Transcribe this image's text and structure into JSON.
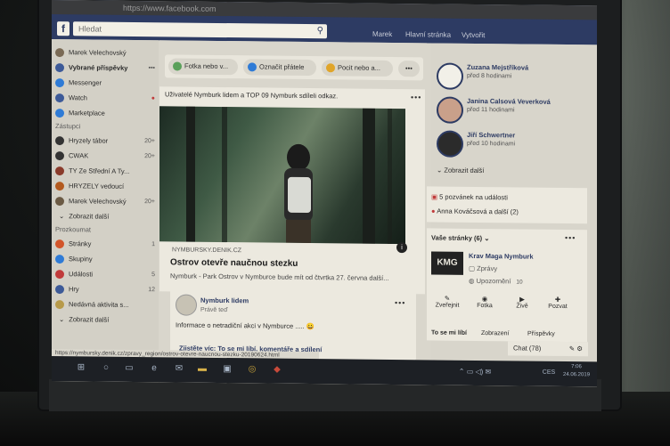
{
  "browser": {
    "url": "https://www.facebook.com",
    "status_url": "https://nymbursky.denik.cz/zpravy_region/ostrov-otevre-naucnou-stezku-20190624.html"
  },
  "fb": {
    "logo": "f",
    "search_placeholder": "Hledat",
    "nav": [
      "Marek",
      "Hlavní stránka",
      "Vytvořit"
    ]
  },
  "sidebar": {
    "profile": "Marek Velechovský",
    "items": [
      {
        "label": "Vybrané příspěvky",
        "color": "#3d5a98"
      },
      {
        "label": "Messenger",
        "color": "#2f7bd6"
      },
      {
        "label": "Watch",
        "color": "#3d5a98"
      },
      {
        "label": "Marketplace",
        "color": "#2f7bd6"
      }
    ],
    "shortcuts_title": "Zástupci",
    "shortcuts": [
      {
        "label": "Hryzely tábor",
        "count": "20+",
        "color": "#333"
      },
      {
        "label": "CWAK",
        "count": "20+",
        "color": "#333"
      },
      {
        "label": "TY Ze Střední A Ty...",
        "count": "",
        "color": "#8a3b2b"
      },
      {
        "label": "HRYZELY vedoucí",
        "count": "",
        "color": "#b35a1f"
      },
      {
        "label": "Marek Velechovský",
        "count": "20+",
        "color": "#6b5a44"
      }
    ],
    "shortcuts_more": "Zobrazit další",
    "explore_title": "Prozkoumat",
    "explore": [
      {
        "label": "Stránky",
        "count": "1",
        "color": "#d2552a"
      },
      {
        "label": "Skupiny",
        "count": "",
        "color": "#2f7bd6"
      },
      {
        "label": "Události",
        "count": "5",
        "color": "#c03b3b"
      },
      {
        "label": "Hry",
        "count": "12",
        "color": "#3d5a98"
      },
      {
        "label": "Nedávná aktivita s...",
        "count": "",
        "color": "#b79a4a"
      }
    ],
    "explore_more": "Zobrazit další"
  },
  "composer": {
    "buttons": [
      "Fotka nebo v...",
      "Označit přátele",
      "Pocit nebo a..."
    ]
  },
  "post": {
    "header": "Uživatelé Nymburk lidem a TOP 09 Nymburk sdíleli odkaz.",
    "domain": "NYMBURSKY.DENIK.CZ",
    "title": "Ostrov otevře naučnou stezku",
    "description": "Nymburk - Park Ostrov v Nymburce bude mít od čtvrtka 27. června další...",
    "info_icon": "i"
  },
  "post2": {
    "author": "Nymburk lidem",
    "time": "Právě teď",
    "text": "Informace o netradiční akci v Nymburce ..... 😀",
    "cta": "Zjistěte víc: To se mi líbí, komentáře a sdílení"
  },
  "contacts": [
    {
      "name": "Zuzana Mejstříková",
      "time": "před 8 hodinami"
    },
    {
      "name": "Janina Calsová Veverková",
      "time": "před 11 hodinami"
    },
    {
      "name": "Jiří Schwertner",
      "time": "před 10 hodinami"
    }
  ],
  "contacts_more": "Zobrazit další",
  "events": {
    "invites": "5 pozvánek na události",
    "birthday": "Anna Kováčsová a další (2)"
  },
  "pages": {
    "title": "Vaše stránky (6)",
    "name": "Krav Maga Nymburk",
    "logo": "KMG",
    "messages": "Zprávy",
    "notifications": "Upozornění",
    "notif_count": "10",
    "actions": [
      "Zveřejnit",
      "Fotka",
      "Živě",
      "Pozvat"
    ],
    "tabs": [
      "To se mi líbí",
      "Zobrazení",
      "Příspěvky"
    ]
  },
  "chat": {
    "label": "Chat (78)"
  },
  "taskbar": {
    "lang": "CES",
    "time": "7:06",
    "date": "24.06.2019"
  }
}
